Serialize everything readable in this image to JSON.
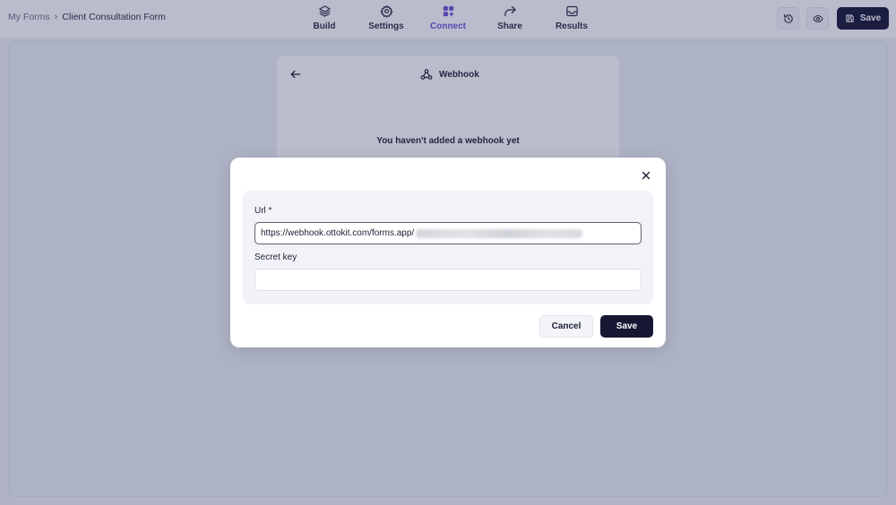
{
  "breadcrumb": {
    "root": "My Forms",
    "separator": "›",
    "current": "Client Consultation Form"
  },
  "nav": {
    "items": [
      {
        "label": "Build",
        "icon": "layers-icon",
        "active": false
      },
      {
        "label": "Settings",
        "icon": "gear-icon",
        "active": false
      },
      {
        "label": "Connect",
        "icon": "grid-plus-icon",
        "active": true
      },
      {
        "label": "Share",
        "icon": "share-arrow-icon",
        "active": false
      },
      {
        "label": "Results",
        "icon": "inbox-icon",
        "active": false
      }
    ]
  },
  "toolbar": {
    "history_icon": "history-icon",
    "preview_icon": "eye-icon",
    "save_label": "Save",
    "save_icon": "floppy-disk-icon"
  },
  "panel": {
    "title": "Webhook",
    "title_icon": "webhook-icon",
    "back_icon": "arrow-left-icon",
    "empty_message": "You haven't added a webhook yet"
  },
  "modal": {
    "close_icon": "close-icon",
    "url_label": "Url *",
    "url_value": "https://webhook.ottokit.com/forms.app/",
    "secret_label": "Secret key",
    "secret_value": "",
    "cancel_label": "Cancel",
    "save_label": "Save"
  },
  "colors": {
    "accent": "#6d52d6",
    "primary_button": "#151733",
    "overlay": "rgba(40,48,95,0.32)"
  }
}
